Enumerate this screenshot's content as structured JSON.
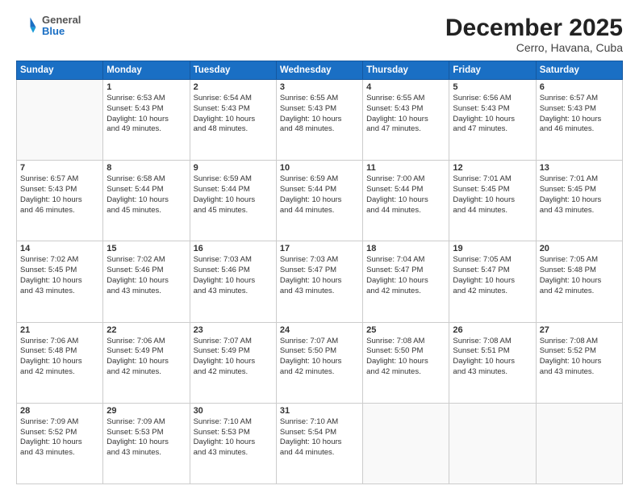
{
  "header": {
    "logo": {
      "general": "General",
      "blue": "Blue"
    },
    "title": "December 2025",
    "subtitle": "Cerro, Havana, Cuba"
  },
  "weekdays": [
    "Sunday",
    "Monday",
    "Tuesday",
    "Wednesday",
    "Thursday",
    "Friday",
    "Saturday"
  ],
  "weeks": [
    [
      {
        "day": "",
        "sunrise": "",
        "sunset": "",
        "daylight": ""
      },
      {
        "day": "1",
        "sunrise": "Sunrise: 6:53 AM",
        "sunset": "Sunset: 5:43 PM",
        "daylight": "Daylight: 10 hours and 49 minutes."
      },
      {
        "day": "2",
        "sunrise": "Sunrise: 6:54 AM",
        "sunset": "Sunset: 5:43 PM",
        "daylight": "Daylight: 10 hours and 48 minutes."
      },
      {
        "day": "3",
        "sunrise": "Sunrise: 6:55 AM",
        "sunset": "Sunset: 5:43 PM",
        "daylight": "Daylight: 10 hours and 48 minutes."
      },
      {
        "day": "4",
        "sunrise": "Sunrise: 6:55 AM",
        "sunset": "Sunset: 5:43 PM",
        "daylight": "Daylight: 10 hours and 47 minutes."
      },
      {
        "day": "5",
        "sunrise": "Sunrise: 6:56 AM",
        "sunset": "Sunset: 5:43 PM",
        "daylight": "Daylight: 10 hours and 47 minutes."
      },
      {
        "day": "6",
        "sunrise": "Sunrise: 6:57 AM",
        "sunset": "Sunset: 5:43 PM",
        "daylight": "Daylight: 10 hours and 46 minutes."
      }
    ],
    [
      {
        "day": "7",
        "sunrise": "Sunrise: 6:57 AM",
        "sunset": "Sunset: 5:43 PM",
        "daylight": "Daylight: 10 hours and 46 minutes."
      },
      {
        "day": "8",
        "sunrise": "Sunrise: 6:58 AM",
        "sunset": "Sunset: 5:44 PM",
        "daylight": "Daylight: 10 hours and 45 minutes."
      },
      {
        "day": "9",
        "sunrise": "Sunrise: 6:59 AM",
        "sunset": "Sunset: 5:44 PM",
        "daylight": "Daylight: 10 hours and 45 minutes."
      },
      {
        "day": "10",
        "sunrise": "Sunrise: 6:59 AM",
        "sunset": "Sunset: 5:44 PM",
        "daylight": "Daylight: 10 hours and 44 minutes."
      },
      {
        "day": "11",
        "sunrise": "Sunrise: 7:00 AM",
        "sunset": "Sunset: 5:44 PM",
        "daylight": "Daylight: 10 hours and 44 minutes."
      },
      {
        "day": "12",
        "sunrise": "Sunrise: 7:01 AM",
        "sunset": "Sunset: 5:45 PM",
        "daylight": "Daylight: 10 hours and 44 minutes."
      },
      {
        "day": "13",
        "sunrise": "Sunrise: 7:01 AM",
        "sunset": "Sunset: 5:45 PM",
        "daylight": "Daylight: 10 hours and 43 minutes."
      }
    ],
    [
      {
        "day": "14",
        "sunrise": "Sunrise: 7:02 AM",
        "sunset": "Sunset: 5:45 PM",
        "daylight": "Daylight: 10 hours and 43 minutes."
      },
      {
        "day": "15",
        "sunrise": "Sunrise: 7:02 AM",
        "sunset": "Sunset: 5:46 PM",
        "daylight": "Daylight: 10 hours and 43 minutes."
      },
      {
        "day": "16",
        "sunrise": "Sunrise: 7:03 AM",
        "sunset": "Sunset: 5:46 PM",
        "daylight": "Daylight: 10 hours and 43 minutes."
      },
      {
        "day": "17",
        "sunrise": "Sunrise: 7:03 AM",
        "sunset": "Sunset: 5:47 PM",
        "daylight": "Daylight: 10 hours and 43 minutes."
      },
      {
        "day": "18",
        "sunrise": "Sunrise: 7:04 AM",
        "sunset": "Sunset: 5:47 PM",
        "daylight": "Daylight: 10 hours and 42 minutes."
      },
      {
        "day": "19",
        "sunrise": "Sunrise: 7:05 AM",
        "sunset": "Sunset: 5:47 PM",
        "daylight": "Daylight: 10 hours and 42 minutes."
      },
      {
        "day": "20",
        "sunrise": "Sunrise: 7:05 AM",
        "sunset": "Sunset: 5:48 PM",
        "daylight": "Daylight: 10 hours and 42 minutes."
      }
    ],
    [
      {
        "day": "21",
        "sunrise": "Sunrise: 7:06 AM",
        "sunset": "Sunset: 5:48 PM",
        "daylight": "Daylight: 10 hours and 42 minutes."
      },
      {
        "day": "22",
        "sunrise": "Sunrise: 7:06 AM",
        "sunset": "Sunset: 5:49 PM",
        "daylight": "Daylight: 10 hours and 42 minutes."
      },
      {
        "day": "23",
        "sunrise": "Sunrise: 7:07 AM",
        "sunset": "Sunset: 5:49 PM",
        "daylight": "Daylight: 10 hours and 42 minutes."
      },
      {
        "day": "24",
        "sunrise": "Sunrise: 7:07 AM",
        "sunset": "Sunset: 5:50 PM",
        "daylight": "Daylight: 10 hours and 42 minutes."
      },
      {
        "day": "25",
        "sunrise": "Sunrise: 7:08 AM",
        "sunset": "Sunset: 5:50 PM",
        "daylight": "Daylight: 10 hours and 42 minutes."
      },
      {
        "day": "26",
        "sunrise": "Sunrise: 7:08 AM",
        "sunset": "Sunset: 5:51 PM",
        "daylight": "Daylight: 10 hours and 43 minutes."
      },
      {
        "day": "27",
        "sunrise": "Sunrise: 7:08 AM",
        "sunset": "Sunset: 5:52 PM",
        "daylight": "Daylight: 10 hours and 43 minutes."
      }
    ],
    [
      {
        "day": "28",
        "sunrise": "Sunrise: 7:09 AM",
        "sunset": "Sunset: 5:52 PM",
        "daylight": "Daylight: 10 hours and 43 minutes."
      },
      {
        "day": "29",
        "sunrise": "Sunrise: 7:09 AM",
        "sunset": "Sunset: 5:53 PM",
        "daylight": "Daylight: 10 hours and 43 minutes."
      },
      {
        "day": "30",
        "sunrise": "Sunrise: 7:10 AM",
        "sunset": "Sunset: 5:53 PM",
        "daylight": "Daylight: 10 hours and 43 minutes."
      },
      {
        "day": "31",
        "sunrise": "Sunrise: 7:10 AM",
        "sunset": "Sunset: 5:54 PM",
        "daylight": "Daylight: 10 hours and 44 minutes."
      },
      {
        "day": "",
        "sunrise": "",
        "sunset": "",
        "daylight": ""
      },
      {
        "day": "",
        "sunrise": "",
        "sunset": "",
        "daylight": ""
      },
      {
        "day": "",
        "sunrise": "",
        "sunset": "",
        "daylight": ""
      }
    ]
  ]
}
